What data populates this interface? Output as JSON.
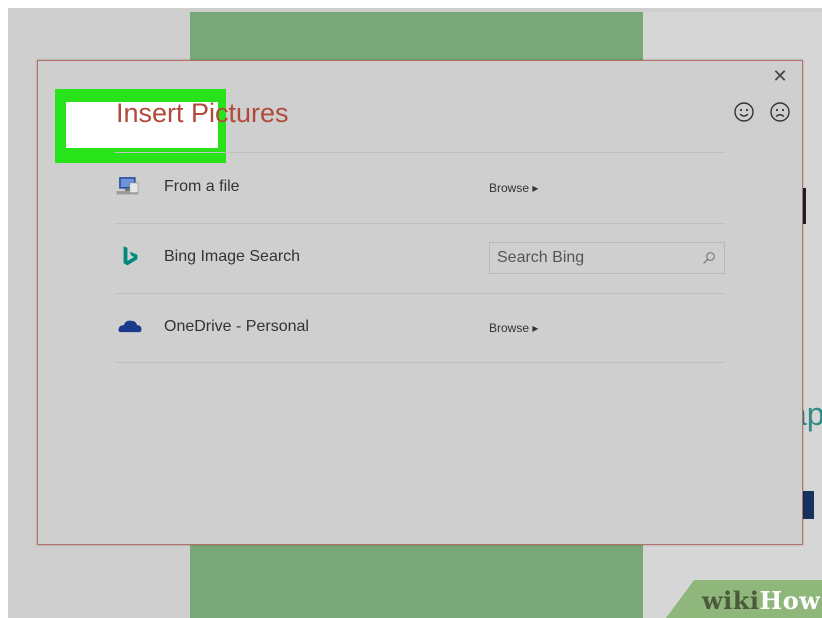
{
  "dialog": {
    "title": "Insert Pictures",
    "close_icon": "close-icon",
    "feedback": {
      "smiley_icon": "smiley-icon",
      "frown_icon": "frown-icon"
    }
  },
  "sources": [
    {
      "label": "From a file",
      "action": "Browse ▸",
      "icon": "computer-icon"
    },
    {
      "label": "Bing Image Search",
      "search_placeholder": "Search Bing",
      "icon": "bing-icon"
    },
    {
      "label": "OneDrive - Personal",
      "action": "Browse ▸",
      "icon": "onedrive-cloud-icon"
    }
  ],
  "colors": {
    "title": "#b24a3c",
    "highlight": "#28e31a",
    "bing": "#00897b",
    "onedrive": "#1b3a8c",
    "dialog_bg": "#cfcfcf"
  },
  "watermark": {
    "wiki": "wiki",
    "how": "How"
  }
}
